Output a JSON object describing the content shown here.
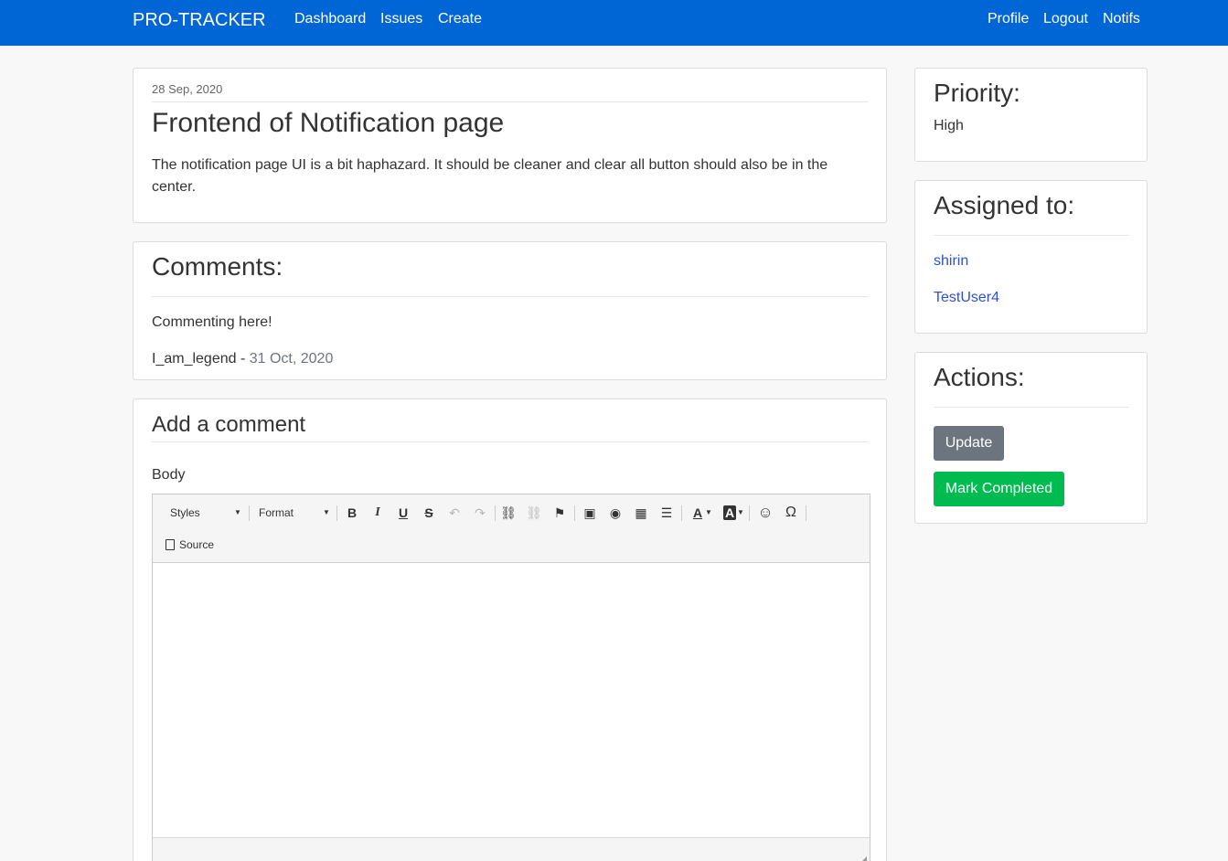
{
  "navbar": {
    "brand": "PRO-TRACKER",
    "left_links": [
      "Dashboard",
      "Issues",
      "Create"
    ],
    "right_links": [
      "Profile",
      "Logout",
      "Notifs"
    ],
    "color": "#0066d6"
  },
  "issue": {
    "date": "28 Sep, 2020",
    "title": "Frontend of Notification page",
    "description": "The notification page UI is a bit haphazard. It should be cleaner and clear all button should also be in the center."
  },
  "comments": {
    "heading": "Comments:",
    "items": [
      {
        "text": "Commenting here!",
        "author": "I_am_legend",
        "separator": " - ",
        "date": "31 Oct, 2020"
      }
    ]
  },
  "add_comment": {
    "heading": "Add a comment",
    "body_label": "Body",
    "editor": {
      "styles_label": "Styles",
      "format_label": "Format",
      "source_label": "Source",
      "buttons": {
        "bold": "B",
        "italic": "I",
        "underline": "U",
        "strike": "S",
        "undo": "↶",
        "redo": "↷",
        "link": "⛓",
        "unlink": "⛓",
        "anchor": "⚑",
        "image": "▣",
        "flash": "◉",
        "table": "▦",
        "hr": "☰",
        "text_color": "A",
        "bg_color": "A",
        "smiley": "☺",
        "special_char": "Ω"
      },
      "icons": [
        "bold-icon",
        "italic-icon",
        "underline-icon",
        "strikethrough-icon",
        "undo-icon",
        "redo-icon",
        "link-icon",
        "unlink-icon",
        "anchor-icon",
        "image-icon",
        "flash-icon",
        "table-icon",
        "horizontal-rule-icon",
        "text-color-icon",
        "background-color-icon",
        "smiley-icon",
        "special-character-icon",
        "source-icon"
      ]
    }
  },
  "priority": {
    "heading": "Priority:",
    "value": "High"
  },
  "assigned": {
    "heading": "Assigned to:",
    "users": [
      "shirin",
      "TestUser4"
    ]
  },
  "actions": {
    "heading": "Actions:",
    "update_label": "Update",
    "complete_label": "Mark Completed",
    "update_color": "#6c757d",
    "complete_color": "#00bb4f"
  }
}
